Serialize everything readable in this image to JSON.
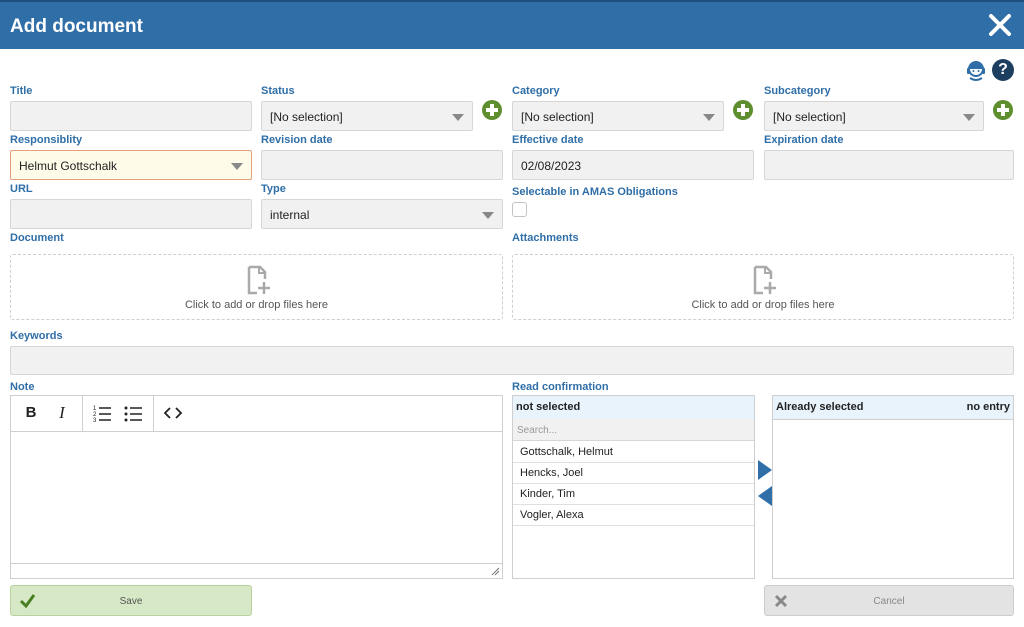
{
  "dialog": {
    "title": "Add document"
  },
  "fields": {
    "title": {
      "label": "Title",
      "value": ""
    },
    "status": {
      "label": "Status",
      "value": "[No selection]"
    },
    "category": {
      "label": "Category",
      "value": "[No selection]"
    },
    "subcategory": {
      "label": "Subcategory",
      "value": "[No selection]"
    },
    "responsibility": {
      "label": "Responsiblity",
      "value": "Helmut Gottschalk"
    },
    "revision_date": {
      "label": "Revision date",
      "value": ""
    },
    "effective_date": {
      "label": "Effective date",
      "value": "02/08/2023"
    },
    "expiration_date": {
      "label": "Expiration date",
      "value": ""
    },
    "url": {
      "label": "URL",
      "value": ""
    },
    "type": {
      "label": "Type",
      "value": "internal"
    },
    "amas": {
      "label": "Selectable in AMAS Obligations",
      "checked": false
    },
    "document": {
      "label": "Document",
      "drop_text": "Click to add or drop files here"
    },
    "attachments": {
      "label": "Attachments",
      "drop_text": "Click to add or drop files here"
    },
    "keywords": {
      "label": "Keywords",
      "value": ""
    },
    "note": {
      "label": "Note"
    }
  },
  "read_confirmation": {
    "label": "Read confirmation",
    "not_selected_header": "not selected",
    "search_placeholder": "Search...",
    "people": [
      "Gottschalk, Helmut",
      "Hencks, Joel",
      "Kinder, Tim",
      "Vogler, Alexa"
    ],
    "already_selected_header": "Already selected",
    "no_entry": "no entry"
  },
  "buttons": {
    "save": "Save",
    "cancel": "Cancel"
  },
  "colors": {
    "header": "#2f6ea7",
    "label": "#2f6ea7",
    "plus": "#5e8e2e",
    "save_bg": "#d6e8c5"
  },
  "icons": [
    "close-icon",
    "support-agent-icon",
    "help-icon",
    "add-icon",
    "dropdown-arrow-icon",
    "add-file-icon",
    "bold-icon",
    "italic-icon",
    "ordered-list-icon",
    "unordered-list-icon",
    "code-icon",
    "arrow-right-icon",
    "arrow-left-icon",
    "check-icon",
    "x-icon"
  ]
}
